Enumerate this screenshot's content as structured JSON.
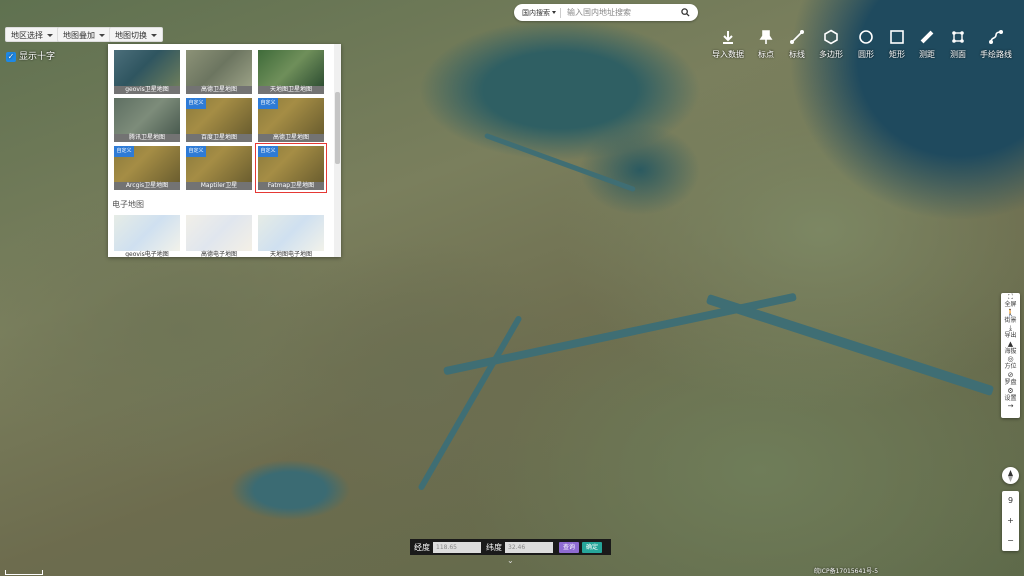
{
  "header": {
    "dropdowns": [
      "地区选择",
      "地图叠加",
      "地图切换"
    ],
    "crosshair_label": "显示十字",
    "crosshair_checked": true
  },
  "search": {
    "scope": "国内搜索",
    "placeholder": "输入国内地址搜索"
  },
  "toolbar": {
    "items": [
      {
        "label": "导入数据",
        "icon": "download-icon"
      },
      {
        "label": "标点",
        "icon": "pin-icon"
      },
      {
        "label": "标线",
        "icon": "polyline-icon"
      },
      {
        "label": "多边形",
        "icon": "hexagon-icon"
      },
      {
        "label": "圆形",
        "icon": "circle-icon"
      },
      {
        "label": "矩形",
        "icon": "rectangle-icon"
      },
      {
        "label": "测距",
        "icon": "ruler-icon"
      },
      {
        "label": "测面",
        "icon": "area-measure-icon"
      },
      {
        "label": "手绘路线",
        "icon": "freehand-route-icon"
      }
    ]
  },
  "map_panel": {
    "satellite_tiles": [
      {
        "label": "geovis卫星地图",
        "ribbon": ""
      },
      {
        "label": "高德卫星地图",
        "ribbon": ""
      },
      {
        "label": "天地图卫星地图",
        "ribbon": ""
      },
      {
        "label": "腾讯卫星地图",
        "ribbon": ""
      },
      {
        "label": "百度卫星地图",
        "ribbon": "自定义"
      },
      {
        "label": "高德卫星地图",
        "ribbon": "自定义"
      },
      {
        "label": "Arcgis卫星地图",
        "ribbon": "自定义"
      },
      {
        "label": "Maptiler卫星",
        "ribbon": "自定义"
      },
      {
        "label": "Fatmap卫星地图",
        "ribbon": "自定义",
        "selected": true
      }
    ],
    "electronic_section_title": "电子地图",
    "electronic_tiles": [
      {
        "label": "geovis电子地图"
      },
      {
        "label": "高德电子地图"
      },
      {
        "label": "天地图电子地图"
      }
    ]
  },
  "right_tools": [
    {
      "label": "全屏",
      "glyph": "⛶"
    },
    {
      "label": "街景",
      "glyph": "🚶"
    },
    {
      "label": "导出",
      "glyph": "⤓"
    },
    {
      "label": "海拔",
      "glyph": "▲"
    },
    {
      "label": "方位",
      "glyph": "◎"
    },
    {
      "label": "罗盘",
      "glyph": "⊘"
    },
    {
      "label": "设置",
      "glyph": "⚙"
    },
    {
      "label": "",
      "glyph": "→"
    }
  ],
  "zoom": {
    "level": "9",
    "plus": "+",
    "minus": "−"
  },
  "coords": {
    "lon_label": "经度",
    "lon_value": "118.65",
    "lat_label": "纬度",
    "lat_value": "32.46",
    "query_label": "查询",
    "locate_label": "确定"
  },
  "footer": {
    "icp": "皖ICP备17015641号-5"
  },
  "colors": {
    "accent_blue": "#1e88e5",
    "selected_border": "#e53935",
    "query_button": "#8e6bd1",
    "locate_button": "#26a69a"
  }
}
